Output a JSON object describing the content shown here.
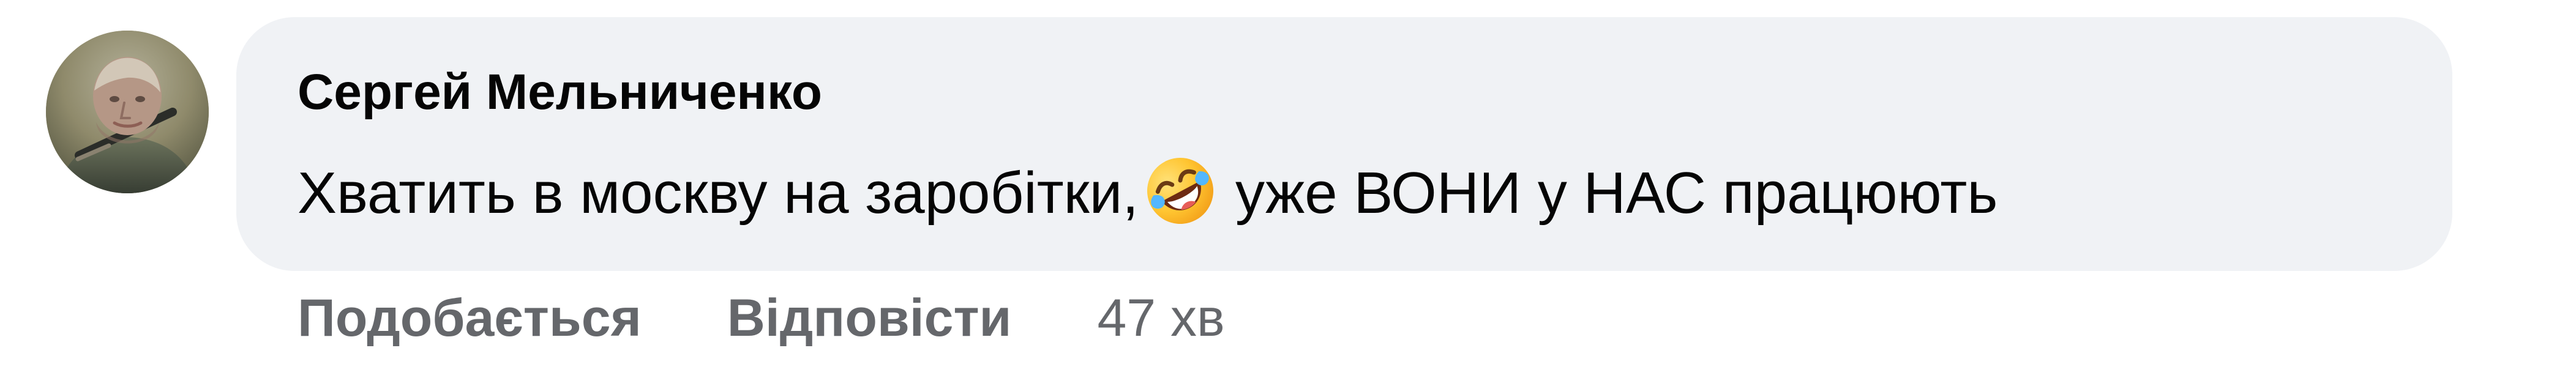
{
  "comment": {
    "author": "Сергей Мельниченко",
    "text_before_emoji": "Хватить в москву на заробітки,",
    "emoji": "rolling-on-the-floor-laughing-emoji",
    "text_after_emoji": "уже ВОНИ у НАС працюють",
    "avatar_icon": "person-avatar-icon",
    "bubble_color": "#f0f2f5",
    "text_color": "#050505"
  },
  "actions": {
    "like_label": "Подобається",
    "reply_label": "Відповісти",
    "timestamp": "47 хв",
    "muted_color": "#65676b"
  }
}
